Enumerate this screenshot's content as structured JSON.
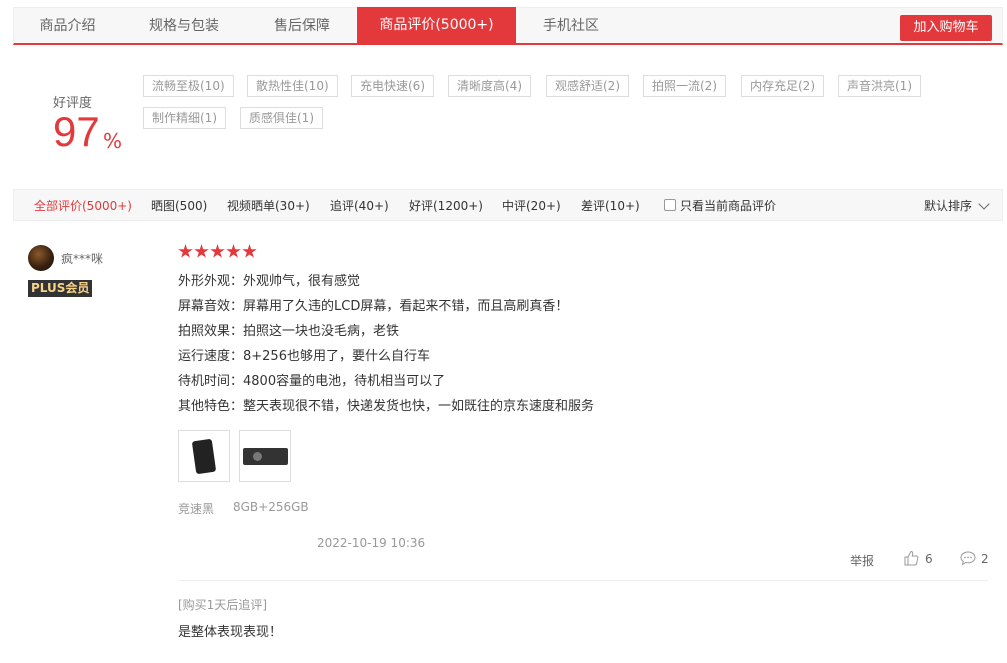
{
  "tabs": [
    {
      "label": "商品介绍"
    },
    {
      "label": "规格与包装"
    },
    {
      "label": "售后保障"
    },
    {
      "label": "商品评价(5000+)"
    },
    {
      "label": "手机社区"
    }
  ],
  "cart_button": "加入购物车",
  "rating": {
    "label": "好评度",
    "value": "97",
    "unit": "%"
  },
  "tags": [
    "流畅至极(10)",
    "散热性佳(10)",
    "充电快速(6)",
    "清晰度高(4)",
    "观感舒适(2)",
    "拍照一流(2)",
    "内存充足(2)",
    "声音洪亮(1)",
    "制作精细(1)",
    "质感俱佳(1)"
  ],
  "filters": [
    "全部评价(5000+)",
    "晒图(500)",
    "视频晒单(30+)",
    "追评(40+)",
    "好评(1200+)",
    "中评(20+)",
    "差评(10+)"
  ],
  "only_current_label": "只看当前商品评价",
  "sort_label": "默认排序",
  "review": {
    "username": "疯***咪",
    "badge": "PLUS会员",
    "stars": 5,
    "lines": [
      "外形外观：外观帅气，很有感觉",
      "屏幕音效：屏幕用了久违的LCD屏幕，看起来不错，而且高刷真香！",
      "拍照效果：拍照这一块也没毛病，老铁",
      "运行速度：8+256也够用了，要什么自行车",
      "待机时间：4800容量的电池，待机相当可以了",
      "其他特色：整天表现很不错，快递发货也快，一如既往的京东速度和服务"
    ],
    "color": "竞速黑",
    "spec": "8GB+256GB",
    "date": "2022-10-19 10:36",
    "report_label": "举报",
    "likes": "6",
    "comments": "2",
    "append_label": "[购买1天后追评]",
    "append_text": "是整体表现表现！"
  },
  "colors": {
    "accent": "#e4393c"
  }
}
